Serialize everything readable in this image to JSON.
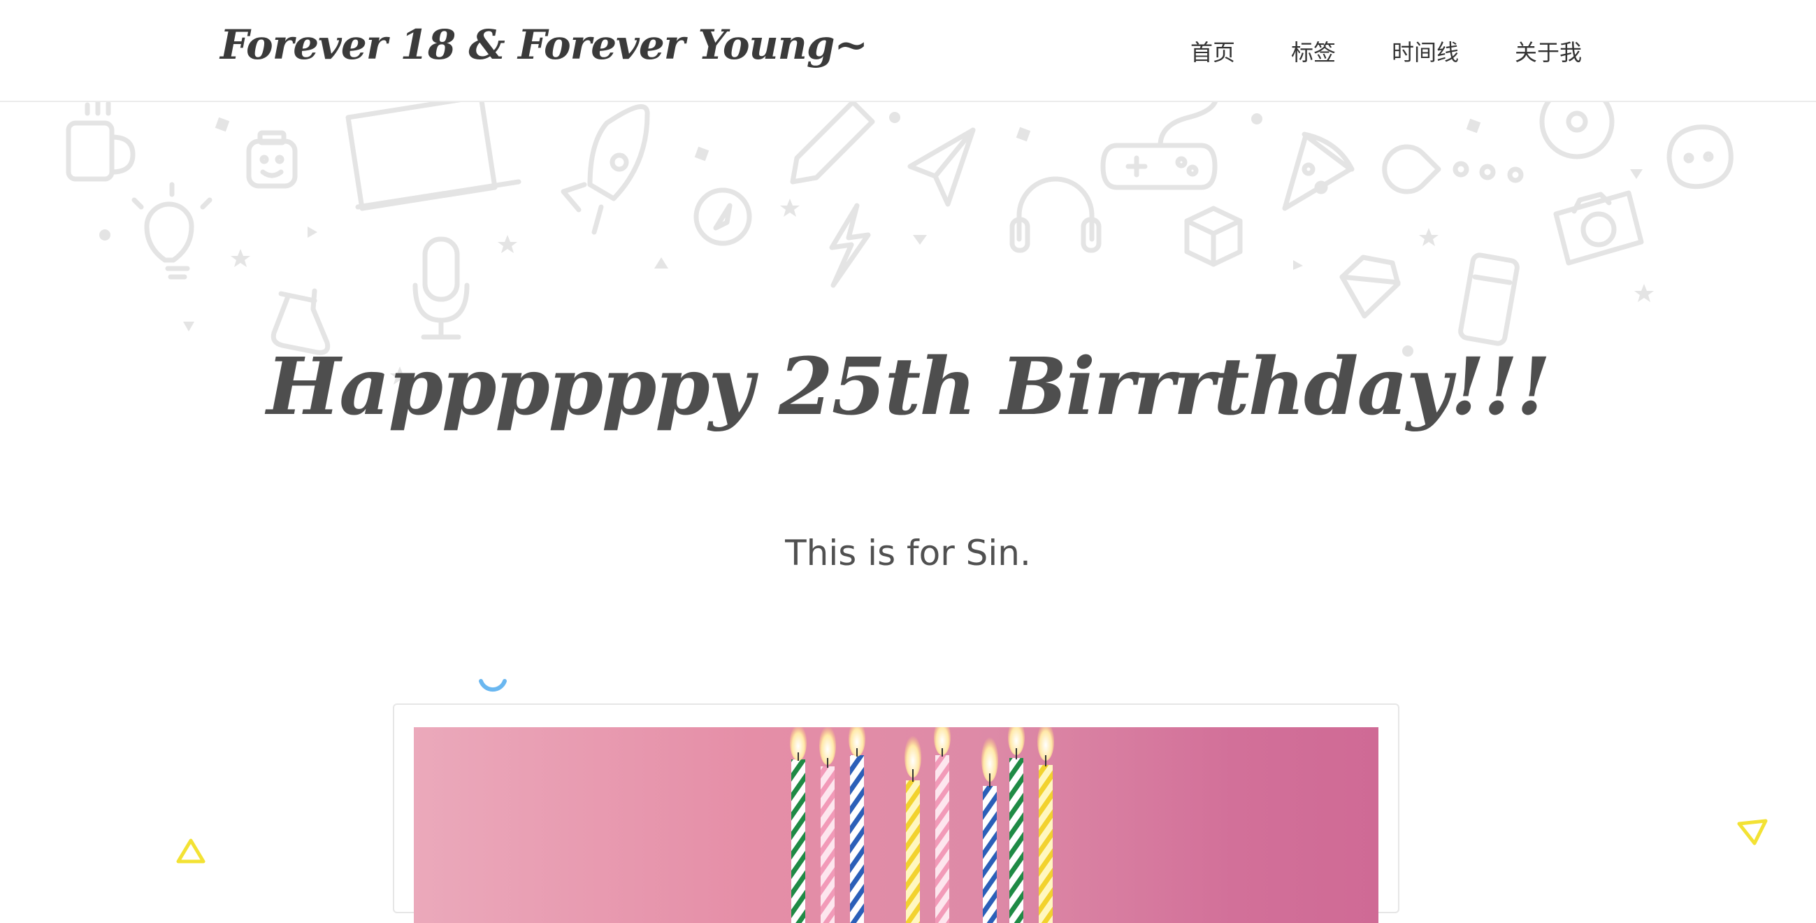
{
  "header": {
    "brand": "Forever 18 & Forever Young~",
    "nav": [
      "首页",
      "标签",
      "时间线",
      "关于我"
    ]
  },
  "hero": {
    "headline": "Happppppy 25th Birrrthday!!!",
    "subtitle": "This is for Sin."
  },
  "icons": {
    "doodles": [
      "coffee-mug-icon",
      "lego-head-icon",
      "laptop-icon",
      "rocket-icon",
      "pencil-icon",
      "paper-plane-icon",
      "gamepad-icon",
      "pizza-icon",
      "pacman-icon",
      "cd-icon",
      "emoji-icon",
      "lightbulb-icon",
      "compass-icon",
      "lightning-icon",
      "headphones-icon",
      "lego-brick-icon",
      "camera-icon",
      "microphone-icon",
      "flask-icon",
      "diamond-icon",
      "phone-icon"
    ],
    "loading": "loading-spinner-icon",
    "decor": "triangle-icon"
  },
  "colors": {
    "doodle": "#e3e3e3",
    "spinner": "#6ab7f0",
    "triangle": "#f3e234",
    "photo_pink": "#e58ea7"
  }
}
